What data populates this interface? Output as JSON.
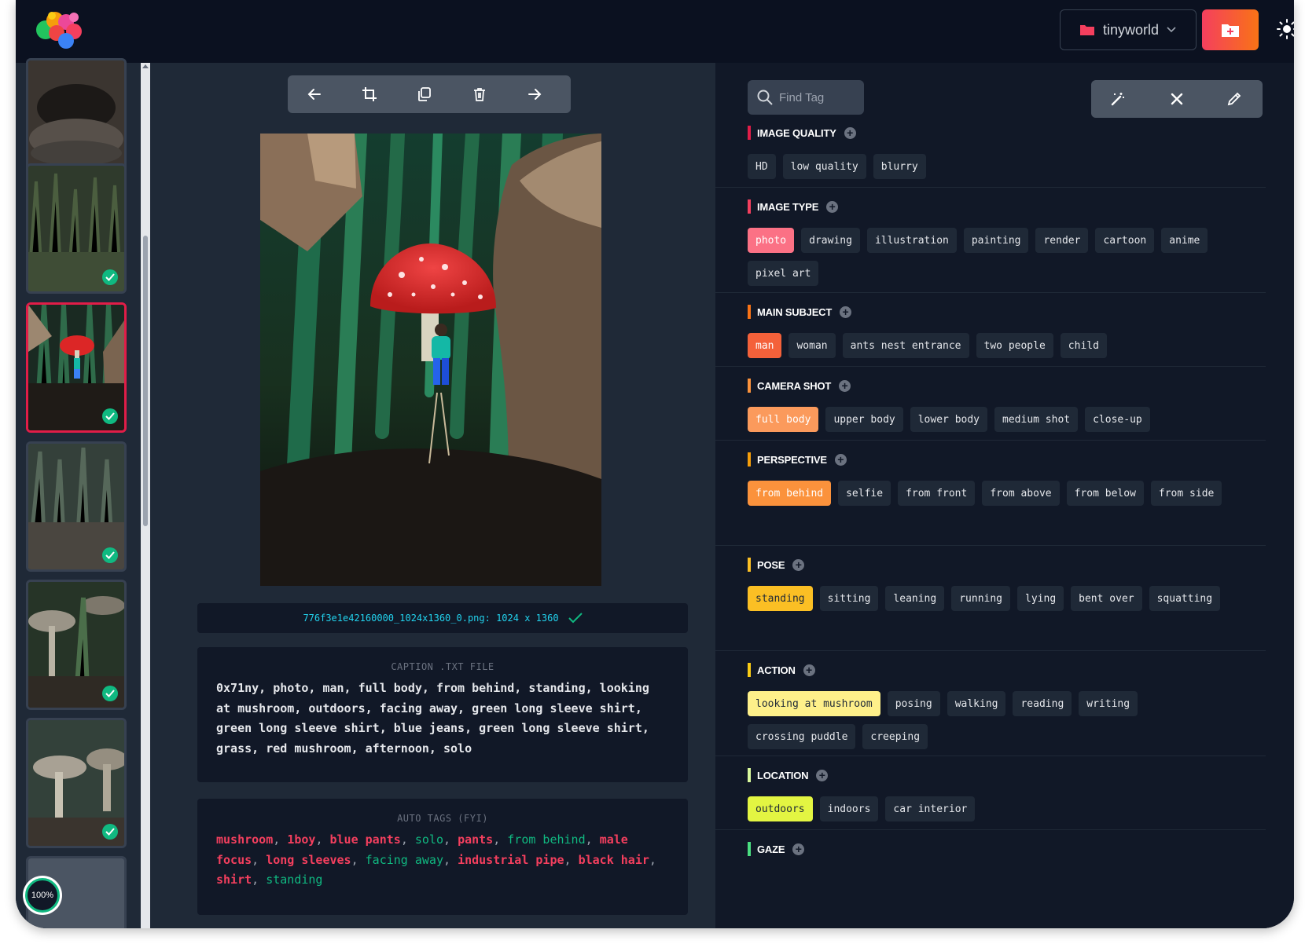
{
  "app": {
    "project_name": "tinyworld",
    "progress": "100%"
  },
  "toolbar": {
    "tools": [
      "arrow-left-icon",
      "crop-icon",
      "duplicate-icon",
      "trash-icon",
      "arrow-right-icon"
    ]
  },
  "image": {
    "file_info": "776f3e1e42160000_1024x1360_0.png: 1024 x 1360"
  },
  "caption": {
    "title": "CAPTION .TXT FILE",
    "text": "0x71ny, photo, man, full body, from behind, standing, looking at mushroom, outdoors, facing away, green long sleeve shirt, green long sleeve shirt, blue jeans, green long sleeve shirt, grass, red mushroom, afternoon, solo"
  },
  "auto_tags": {
    "title": "AUTO TAGS (FYI)",
    "items": [
      {
        "text": "mushroom",
        "color": "#f43f5e"
      },
      {
        "text": "1boy",
        "color": "#f43f5e"
      },
      {
        "text": "blue pants",
        "color": "#f43f5e"
      },
      {
        "text": "solo",
        "color": "#10b981"
      },
      {
        "text": "pants",
        "color": "#f43f5e"
      },
      {
        "text": "from behind",
        "color": "#10b981"
      },
      {
        "text": "male focus",
        "color": "#f43f5e"
      },
      {
        "text": "long sleeves",
        "color": "#f43f5e"
      },
      {
        "text": "facing away",
        "color": "#10b981"
      },
      {
        "text": "industrial pipe",
        "color": "#f43f5e"
      },
      {
        "text": "black hair",
        "color": "#f43f5e"
      },
      {
        "text": "shirt",
        "color": "#f43f5e"
      },
      {
        "text": "standing",
        "color": "#10b981"
      }
    ]
  },
  "search": {
    "placeholder": "Find Tag"
  },
  "right_tools": [
    "magic-wand-icon",
    "close-icon",
    "pencil-icon"
  ],
  "sections": [
    {
      "title": "IMAGE QUALITY",
      "color": "#e11d48",
      "selected_color": "#e11d48",
      "tags": [
        {
          "label": "HD",
          "selected": false
        },
        {
          "label": "low quality",
          "selected": false
        },
        {
          "label": "blurry",
          "selected": false
        }
      ]
    },
    {
      "title": "IMAGE TYPE",
      "color": "#f43f5e",
      "selected_color": "#fb7185",
      "tags": [
        {
          "label": "photo",
          "selected": true
        },
        {
          "label": "drawing",
          "selected": false
        },
        {
          "label": "illustration",
          "selected": false
        },
        {
          "label": "painting",
          "selected": false
        },
        {
          "label": "render",
          "selected": false
        },
        {
          "label": "cartoon",
          "selected": false
        },
        {
          "label": "anime",
          "selected": false
        },
        {
          "label": "pixel art",
          "selected": false
        }
      ]
    },
    {
      "title": "MAIN SUBJECT",
      "color": "#f97316",
      "selected_color": "#f4613a",
      "tags": [
        {
          "label": "man",
          "selected": true
        },
        {
          "label": "woman",
          "selected": false
        },
        {
          "label": "ants nest entrance",
          "selected": false
        },
        {
          "label": "two people",
          "selected": false
        },
        {
          "label": "child",
          "selected": false
        }
      ]
    },
    {
      "title": "CAMERA SHOT",
      "color": "#fb923c",
      "selected_color": "#fb9a5c",
      "tags": [
        {
          "label": "full body",
          "selected": true
        },
        {
          "label": "upper body",
          "selected": false
        },
        {
          "label": "lower body",
          "selected": false
        },
        {
          "label": "medium shot",
          "selected": false
        },
        {
          "label": "close-up",
          "selected": false
        }
      ]
    },
    {
      "title": "PERSPECTIVE",
      "color": "#f59e0b",
      "selected_color": "#fb923c",
      "tags": [
        {
          "label": "from behind",
          "selected": true
        },
        {
          "label": "selfie",
          "selected": false
        },
        {
          "label": "from front",
          "selected": false
        },
        {
          "label": "from above",
          "selected": false
        },
        {
          "label": "from below",
          "selected": false
        },
        {
          "label": "from side",
          "selected": false
        }
      ]
    },
    {
      "title": "POSE",
      "color": "#fbbf24",
      "selected_color": "#fbbf24",
      "tags": [
        {
          "label": "standing",
          "selected": true
        },
        {
          "label": "sitting",
          "selected": false
        },
        {
          "label": "leaning",
          "selected": false
        },
        {
          "label": "running",
          "selected": false
        },
        {
          "label": "lying",
          "selected": false
        },
        {
          "label": "bent over",
          "selected": false
        },
        {
          "label": "squatting",
          "selected": false
        }
      ]
    },
    {
      "title": "ACTION",
      "color": "#facc15",
      "selected_color": "#fef08a",
      "tags": [
        {
          "label": "looking at mushroom",
          "selected": true
        },
        {
          "label": "posing",
          "selected": false
        },
        {
          "label": "walking",
          "selected": false
        },
        {
          "label": "reading",
          "selected": false
        },
        {
          "label": "writing",
          "selected": false
        },
        {
          "label": "crossing puddle",
          "selected": false
        },
        {
          "label": "creeping",
          "selected": false
        }
      ]
    },
    {
      "title": "LOCATION",
      "color": "#d9f99d",
      "selected_color": "#e3f542",
      "tags": [
        {
          "label": "outdoors",
          "selected": true
        },
        {
          "label": "indoors",
          "selected": false
        },
        {
          "label": "car interior",
          "selected": false
        }
      ]
    },
    {
      "title": "GAZE",
      "color": "#4ade80",
      "selected_color": "#4ade80",
      "tags": []
    }
  ]
}
